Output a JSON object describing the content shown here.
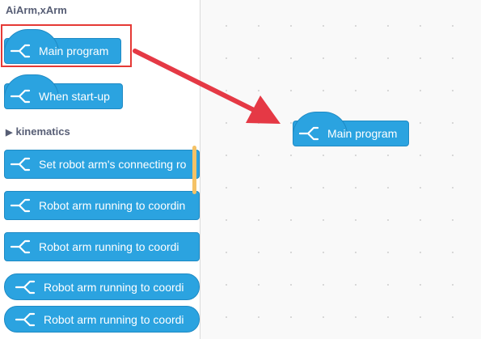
{
  "palette": {
    "category_title": "AiArm,xArm",
    "section_header": "kinematics",
    "blocks": [
      {
        "label": "Main program"
      },
      {
        "label": "When start-up"
      },
      {
        "label": "Set robot arm's connecting ro"
      },
      {
        "label": "Robot arm running to coordin"
      },
      {
        "label": "Robot arm running to coordi"
      },
      {
        "label": "Robot arm running to coordi"
      },
      {
        "label": "Robot arm running to coordi"
      }
    ]
  },
  "workspace": {
    "block": {
      "label": "Main program"
    }
  },
  "icons": {
    "block_icon": "arm-claw-icon",
    "arrow": "arrow-icon"
  },
  "colors": {
    "block_fill": "#2ba3e0",
    "block_border": "#1f8ac4",
    "highlight": "#e53935",
    "arrow": "#e53945"
  }
}
